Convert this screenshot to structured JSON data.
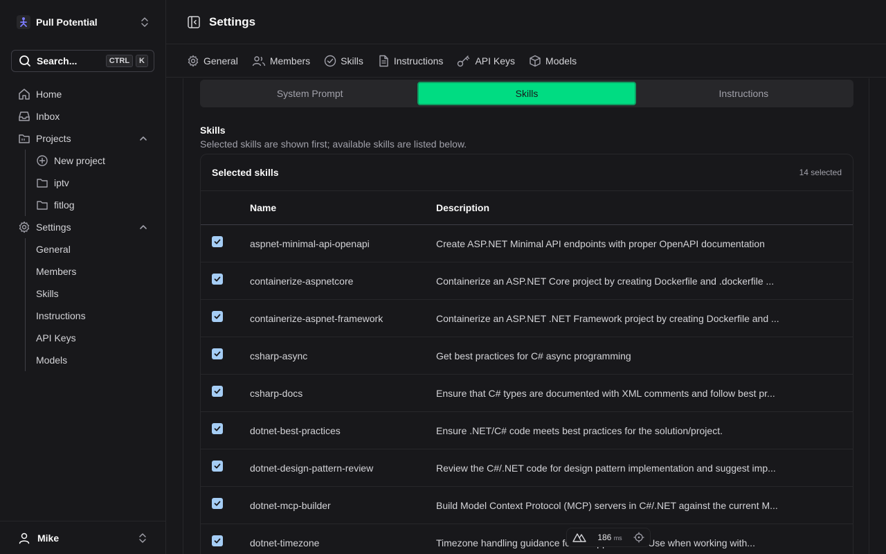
{
  "sidebar": {
    "team": {
      "name": "Pull Potential",
      "logo_color": "#7c7cff"
    },
    "search": {
      "label": "Search...",
      "kbd1": "CTRL",
      "kbd2": "K"
    },
    "items": [
      {
        "label": "Home",
        "icon": "home-icon"
      },
      {
        "label": "Inbox",
        "icon": "inbox-icon"
      },
      {
        "label": "Projects",
        "icon": "folder-icon"
      }
    ],
    "projects": [
      {
        "label": "New project",
        "icon": "plus-circle-icon"
      },
      {
        "label": "iptv",
        "icon": "folder-icon"
      },
      {
        "label": "fitlog",
        "icon": "folder-icon"
      }
    ],
    "settings": {
      "label": "Settings",
      "icon": "gear-icon"
    },
    "settings_items": [
      "General",
      "Members",
      "Skills",
      "Instructions",
      "API Keys",
      "Models"
    ],
    "user": {
      "name": "Mike"
    }
  },
  "header": {
    "title": "Settings"
  },
  "tabs": [
    {
      "label": "General",
      "icon": "gear-icon"
    },
    {
      "label": "Members",
      "icon": "users-icon"
    },
    {
      "label": "Skills",
      "icon": "check-circle-icon"
    },
    {
      "label": "Instructions",
      "icon": "document-icon"
    },
    {
      "label": "API Keys",
      "icon": "key-icon"
    },
    {
      "label": "Models",
      "icon": "cube-icon"
    }
  ],
  "segments": {
    "items": [
      "System Prompt",
      "Skills",
      "Instructions"
    ],
    "active": "Skills",
    "accent": "#00dc82"
  },
  "section": {
    "title": "Skills",
    "description": "Selected skills are shown first; available skills are listed below."
  },
  "card": {
    "title": "Selected skills",
    "count": "14 selected",
    "columns": {
      "name": "Name",
      "description": "Description"
    },
    "rows": [
      {
        "name": "aspnet-minimal-api-openapi",
        "description": "Create ASP.NET Minimal API endpoints with proper OpenAPI documentation",
        "checked": true
      },
      {
        "name": "containerize-aspnetcore",
        "description": "Containerize an ASP.NET Core project by creating Dockerfile and .dockerfile ...",
        "checked": true
      },
      {
        "name": "containerize-aspnet-framework",
        "description": "Containerize an ASP.NET .NET Framework project by creating Dockerfile and ...",
        "checked": true
      },
      {
        "name": "csharp-async",
        "description": "Get best practices for C# async programming",
        "checked": true
      },
      {
        "name": "csharp-docs",
        "description": "Ensure that C# types are documented with XML comments and follow best pr...",
        "checked": true
      },
      {
        "name": "dotnet-best-practices",
        "description": "Ensure .NET/C# code meets best practices for the solution/project.",
        "checked": true
      },
      {
        "name": "dotnet-design-pattern-review",
        "description": "Review the C#/.NET code for design pattern implementation and suggest imp...",
        "checked": true
      },
      {
        "name": "dotnet-mcp-builder",
        "description": "Build Model Context Protocol (MCP) servers in C#/.NET against the current M...",
        "checked": true
      },
      {
        "name": "dotnet-timezone",
        "description": "Timezone handling guidance for C# applications. Use when working with...",
        "checked": true
      }
    ]
  },
  "devbar": {
    "value": "186",
    "unit": "ms"
  }
}
